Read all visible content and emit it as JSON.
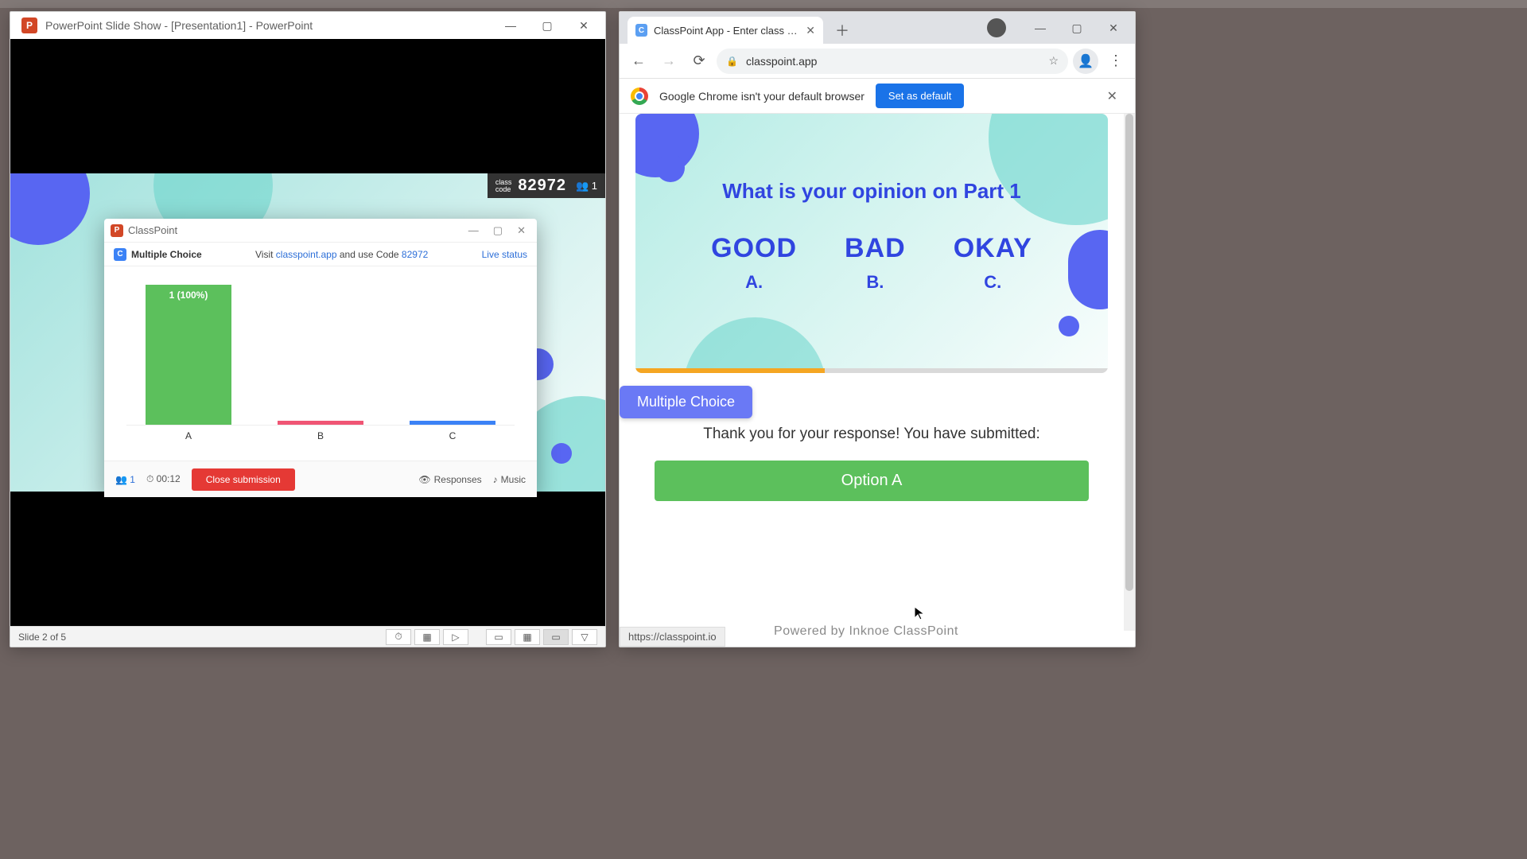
{
  "ppt": {
    "title": "PowerPoint Slide Show - [Presentation1] - PowerPoint",
    "class_code_label": "class\ncode",
    "class_code": "82972",
    "participants": "1",
    "status": "Slide 2 of 5"
  },
  "cp_dialog": {
    "title": "ClassPoint",
    "mc_label": "Multiple Choice",
    "visit_prefix": "Visit ",
    "visit_link": "classpoint.app",
    "visit_mid": " and use Code ",
    "visit_code": "82972",
    "live_status": "Live status",
    "participants": "1",
    "timer": "00:12",
    "close_submission": "Close submission",
    "responses": "Responses",
    "music": "Music"
  },
  "chart_data": {
    "type": "bar",
    "categories": [
      "A",
      "B",
      "C"
    ],
    "values": [
      1,
      0,
      0
    ],
    "labels": [
      "1 (100%)",
      "",
      ""
    ],
    "colors": [
      "#5cc05c",
      "#f05574",
      "#3b82f6"
    ],
    "title": "",
    "xlabel": "",
    "ylabel": "",
    "ylim": [
      0,
      1
    ]
  },
  "chrome": {
    "tab_title": "ClassPoint App - Enter class code",
    "url": "classpoint.app",
    "default_msg": "Google Chrome isn't your default browser",
    "set_default": "Set as default",
    "status_url": "https://classpoint.io"
  },
  "question": {
    "title": "What is your opinion on Part 1",
    "opts": [
      {
        "big": "GOOD",
        "let": "A."
      },
      {
        "big": "BAD",
        "let": "B."
      },
      {
        "big": "OKAY",
        "let": "C."
      }
    ],
    "mc_pill": "Multiple Choice",
    "thanks": "Thank you for your response! You have submitted:",
    "submitted": "Option A",
    "powered": "Powered by Inknoe ClassPoint"
  }
}
